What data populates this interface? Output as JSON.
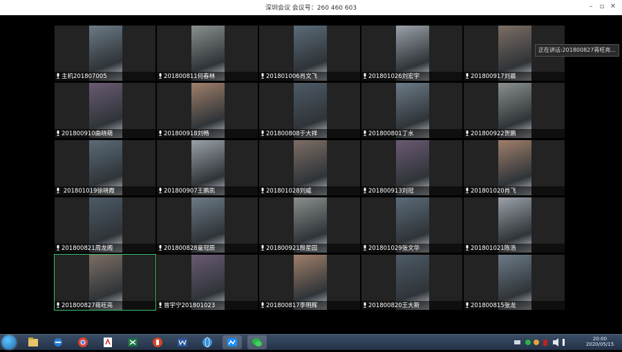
{
  "window": {
    "title": "深圳会议 会议号：260 460 603",
    "min": "–",
    "max": "▫",
    "close": "✕"
  },
  "tooltip": "正在讲话:201800827蒋旺亮...",
  "participants": [
    {
      "label": "主机201807005",
      "active": false
    },
    {
      "label": "201800811何春林",
      "active": false
    },
    {
      "label": "201801006肖文飞",
      "active": false
    },
    {
      "label": "201801026刘宏宇",
      "active": false
    },
    {
      "label": "201800917刘晨",
      "active": false
    },
    {
      "label": "201800910曲晓萌",
      "active": false
    },
    {
      "label": "201800918刘畅",
      "active": false
    },
    {
      "label": "201800808于大祥",
      "active": false
    },
    {
      "label": "201800801丁水",
      "active": false
    },
    {
      "label": "201800922贺鹏",
      "active": false
    },
    {
      "label": " 201801019徐晓霞",
      "active": false
    },
    {
      "label": "201800907王鹏凯",
      "active": false
    },
    {
      "label": "201801028刘威",
      "active": false
    },
    {
      "label": "201800913刘冠",
      "active": false
    },
    {
      "label": "201801020肖飞",
      "active": false
    },
    {
      "label": "201800821周龙阁",
      "active": false
    },
    {
      "label": "201800828童冠辰",
      "active": false
    },
    {
      "label": "201800921殷星园",
      "active": false
    },
    {
      "label": "201801029张文华",
      "active": false
    },
    {
      "label": "201801021陈浩",
      "active": false
    },
    {
      "label": "201800827蒋旺亮",
      "active": true
    },
    {
      "label": "曾宇宁201801023",
      "active": false
    },
    {
      "label": "201800817李明辉",
      "active": false
    },
    {
      "label": "201800820王大新",
      "active": false
    },
    {
      "label": "201800815张龙",
      "active": false
    }
  ],
  "taskbar": {
    "apps": [
      "file-explorer-icon",
      "ie-icon",
      "chrome-icon",
      "pdf-icon",
      "excel-icon",
      "powerpoint-icon",
      "word-icon",
      "globe-icon",
      "meeting-app-icon",
      "wechat-icon"
    ],
    "time": "20:00",
    "date": "2020/05/15"
  }
}
